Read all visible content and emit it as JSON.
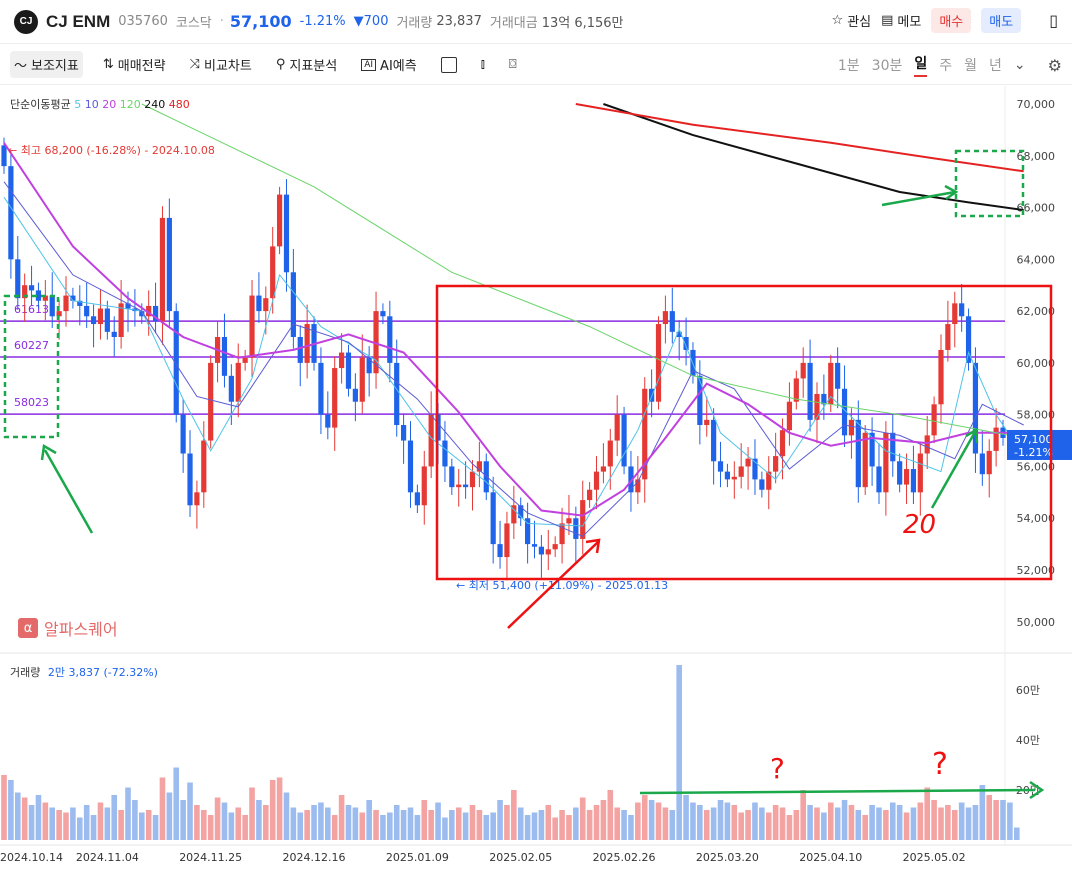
{
  "header": {
    "logo_text": "CJ",
    "name": "CJ ENM",
    "code": "035760",
    "market": "코스닥",
    "price": "57,100",
    "change_pct": "-1.21%",
    "change_abs": "▼700",
    "volume_label": "거래량",
    "volume": "23,837",
    "amount_label": "거래대금",
    "amount": "13억 6,156만",
    "watch_label": "관심",
    "memo_label": "메모",
    "buy_label": "매수",
    "sell_label": "매도"
  },
  "toolbar": {
    "items": [
      "보조지표",
      "매매전략",
      "비교차트",
      "지표분석",
      "AI예측"
    ],
    "periods": [
      "1분",
      "30분",
      "일",
      "주",
      "월",
      "년"
    ],
    "selected_period": "일"
  },
  "indicator": {
    "label": "단순이동평균",
    "periods": [
      "5",
      "10",
      "20",
      "120",
      "240",
      "480"
    ],
    "colors": [
      "#4fc3e8",
      "#5b5bd6",
      "#c040e0",
      "#6ad46a",
      "#111111",
      "#e52222"
    ]
  },
  "annotations": {
    "high_label": "← 최고 68,200 (-16.28%) - 2024.10.08",
    "low_label": "← 최저 51,400 (+11.09%) - 2025.01.13",
    "hlines": [
      {
        "label": "61613",
        "value": 61613
      },
      {
        "label": "60227",
        "value": 60227
      },
      {
        "label": "58023",
        "value": 58023
      }
    ],
    "handwritten_20": "20",
    "question_marks": [
      "?",
      "?"
    ],
    "current_price_tag": "57,100",
    "current_change_tag": "-1.21%"
  },
  "brand": {
    "icon": "α",
    "name": "알파스퀘어"
  },
  "volume_legend": {
    "label": "거래량",
    "value": "2만 3,837 (-72.32%)"
  },
  "colors": {
    "up": "#e53935",
    "down": "#1e63e9",
    "accent_blue": "#1e63e9",
    "accent_red": "#e3342f"
  },
  "chart_data": {
    "type": "candlestick",
    "price_axis": {
      "ticks": [
        50000,
        52000,
        54000,
        56000,
        58000,
        60000,
        62000,
        64000,
        66000,
        68000,
        70000
      ],
      "ylim": [
        49500,
        70500
      ]
    },
    "x_ticks": [
      "2024.10.14",
      "2024.11.04",
      "2024.11.25",
      "2024.12.16",
      "2025.01.09",
      "2025.02.05",
      "2025.02.26",
      "2025.03.20",
      "2025.04.10",
      "2025.05.02"
    ],
    "closes": [
      67600,
      64000,
      62500,
      63000,
      62800,
      62400,
      62600,
      61800,
      62000,
      62600,
      62400,
      62200,
      61800,
      61500,
      62100,
      61200,
      61000,
      62300,
      62100,
      62000,
      61800,
      62200,
      61600,
      65600,
      62000,
      58000,
      56500,
      54500,
      55000,
      57000,
      60000,
      61000,
      59500,
      58500,
      60000,
      60200,
      62600,
      62000,
      62500,
      64500,
      66500,
      63500,
      61000,
      60000,
      61500,
      60000,
      58000,
      57500,
      59800,
      60400,
      59000,
      58500,
      60200,
      59600,
      62000,
      61800,
      60000,
      57600,
      57000,
      55000,
      54500,
      56000,
      58000,
      57000,
      56000,
      55200,
      55300,
      55200,
      55800,
      56200,
      55000,
      53000,
      52500,
      53800,
      54500,
      54000,
      53000,
      52900,
      52600,
      52800,
      53000,
      53800,
      54000,
      53200,
      54700,
      55100,
      55800,
      56000,
      57000,
      58000,
      56000,
      55000,
      55500,
      59000,
      58500,
      61500,
      62000,
      61200,
      61000,
      60500,
      59500,
      57600,
      57800,
      56200,
      55800,
      55500,
      55600,
      56000,
      56300,
      55500,
      55100,
      55800,
      56400,
      57400,
      58500,
      59400,
      60000,
      57800,
      58800,
      58400,
      60000,
      59000,
      57200,
      57800,
      55200,
      57300,
      56000,
      55000,
      57300,
      56200,
      55300,
      55900,
      55000,
      56500,
      57200,
      58400,
      60500,
      61500,
      62300,
      61800,
      60000,
      56500,
      55700,
      56600,
      57500,
      57100
    ],
    "ma_lines": {
      "ma5": [
        [
          0,
          66400
        ],
        [
          10,
          62400
        ],
        [
          20,
          62000
        ],
        [
          26,
          58600
        ],
        [
          30,
          56600
        ],
        [
          36,
          59400
        ],
        [
          40,
          63400
        ],
        [
          46,
          61400
        ],
        [
          54,
          60100
        ],
        [
          62,
          57100
        ],
        [
          70,
          55400
        ],
        [
          76,
          53800
        ],
        [
          84,
          53700
        ],
        [
          92,
          57400
        ],
        [
          98,
          61300
        ],
        [
          104,
          57300
        ],
        [
          112,
          55500
        ],
        [
          120,
          58700
        ],
        [
          128,
          56600
        ],
        [
          136,
          55800
        ],
        [
          140,
          60400
        ],
        [
          144,
          58000
        ],
        [
          148,
          56400
        ]
      ],
      "ma10": [
        [
          0,
          67000
        ],
        [
          10,
          63400
        ],
        [
          20,
          62000
        ],
        [
          28,
          58700
        ],
        [
          34,
          58300
        ],
        [
          42,
          61500
        ],
        [
          50,
          60800
        ],
        [
          60,
          58600
        ],
        [
          68,
          56100
        ],
        [
          76,
          54200
        ],
        [
          84,
          53300
        ],
        [
          92,
          55400
        ],
        [
          100,
          59700
        ],
        [
          106,
          59000
        ],
        [
          114,
          55900
        ],
        [
          122,
          57600
        ],
        [
          130,
          57200
        ],
        [
          138,
          56300
        ],
        [
          142,
          58400
        ],
        [
          148,
          57600
        ]
      ],
      "ma20": [
        [
          0,
          68500
        ],
        [
          10,
          64500
        ],
        [
          18,
          62500
        ],
        [
          26,
          61000
        ],
        [
          34,
          60200
        ],
        [
          42,
          60500
        ],
        [
          50,
          61100
        ],
        [
          58,
          60400
        ],
        [
          66,
          58100
        ],
        [
          72,
          56000
        ],
        [
          78,
          54300
        ],
        [
          84,
          54100
        ],
        [
          90,
          55100
        ],
        [
          96,
          57100
        ],
        [
          102,
          59200
        ],
        [
          108,
          58400
        ],
        [
          114,
          57300
        ],
        [
          120,
          56800
        ],
        [
          126,
          57100
        ],
        [
          134,
          56900
        ],
        [
          140,
          57300
        ],
        [
          148,
          57300
        ]
      ],
      "ma120": [
        [
          20,
          70000
        ],
        [
          45,
          66800
        ],
        [
          65,
          63500
        ],
        [
          85,
          61400
        ],
        [
          100,
          59500
        ],
        [
          115,
          58600
        ],
        [
          130,
          58000
        ],
        [
          148,
          57100
        ]
      ],
      "ma240": [
        [
          87,
          70000
        ],
        [
          100,
          68800
        ],
        [
          115,
          67700
        ],
        [
          130,
          66600
        ],
        [
          140,
          66200
        ],
        [
          148,
          65900
        ]
      ],
      "ma480": [
        [
          83,
          70000
        ],
        [
          100,
          69200
        ],
        [
          120,
          68500
        ],
        [
          135,
          67900
        ],
        [
          148,
          67400
        ]
      ]
    },
    "volume_axis": {
      "ticks": [
        "20만",
        "40만",
        "60만"
      ],
      "unit": "만"
    },
    "volumes": [
      2.6,
      2.4,
      1.9,
      1.7,
      1.4,
      1.8,
      1.5,
      1.3,
      1.2,
      1.1,
      1.3,
      0.9,
      1.4,
      1.0,
      1.5,
      1.3,
      1.8,
      1.2,
      2.1,
      1.6,
      1.1,
      1.2,
      1.0,
      2.5,
      1.9,
      2.9,
      1.6,
      2.3,
      1.4,
      1.2,
      1.0,
      1.7,
      1.5,
      1.1,
      1.3,
      1.0,
      2.1,
      1.6,
      1.4,
      2.4,
      2.5,
      1.9,
      1.3,
      1.1,
      1.2,
      1.4,
      1.5,
      1.3,
      1.0,
      1.8,
      1.4,
      1.3,
      1.1,
      1.6,
      1.2,
      1.0,
      1.1,
      1.4,
      1.2,
      1.3,
      1.0,
      1.6,
      1.2,
      1.5,
      0.9,
      1.2,
      1.3,
      1.1,
      1.4,
      1.2,
      1.0,
      1.1,
      1.6,
      1.4,
      2.0,
      1.3,
      1.0,
      1.1,
      1.2,
      1.4,
      0.9,
      1.2,
      1.0,
      1.3,
      1.7,
      1.2,
      1.4,
      1.6,
      2.0,
      1.3,
      1.2,
      1.0,
      1.5,
      1.8,
      1.6,
      1.5,
      1.3,
      1.2,
      7.0,
      1.8,
      1.5,
      1.4,
      1.2,
      1.3,
      1.6,
      1.5,
      1.4,
      1.1,
      1.2,
      1.5,
      1.3,
      1.1,
      1.4,
      1.3,
      1.0,
      1.2,
      2.0,
      1.4,
      1.3,
      1.1,
      1.5,
      1.3,
      1.6,
      1.4,
      1.2,
      1.0,
      1.4,
      1.3,
      1.2,
      1.5,
      1.4,
      1.1,
      1.3,
      1.5,
      2.1,
      1.6,
      1.3,
      1.4,
      1.2,
      1.5,
      1.3,
      1.4,
      2.2,
      1.8,
      1.6,
      1.6,
      1.5,
      0.5
    ]
  }
}
